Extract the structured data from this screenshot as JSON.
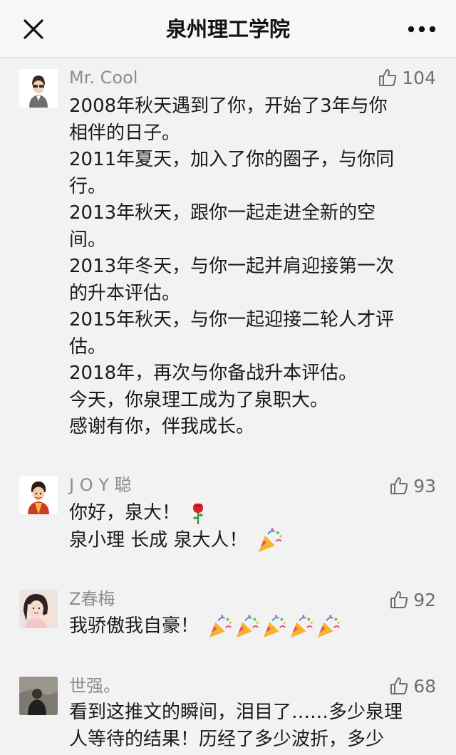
{
  "header": {
    "title": "泉州理工学院",
    "close_icon": "close-icon",
    "more_icon": "more-icon"
  },
  "comments": [
    {
      "name": "Mr. Cool",
      "likes": "104",
      "lines": [
        "2008年秋天遇到了你，开始了3年与你",
        "相伴的日子。",
        "2011年夏天，加入了你的圈子，与你同",
        "行。",
        "2013年秋天，跟你一起走进全新的空",
        "间。",
        "2013年冬天，与你一起并肩迎接第一次",
        "的升本评估。",
        "2015年秋天，与你一起迎接二轮人才评",
        "估。",
        "2018年，再次与你备战升本评估。",
        "今天，你泉理工成为了泉职大。",
        "感谢有你，伴我成长。"
      ]
    },
    {
      "name": "J O Y 聪",
      "likes": "93",
      "lines": [
        "你好，泉大！",
        "泉小理 长成 泉大人！"
      ],
      "emoji": [
        "rose-emoji",
        "party-popper-emoji"
      ]
    },
    {
      "name": "Z春梅",
      "likes": "92",
      "lines": [
        "我骄傲我自豪！"
      ],
      "emoji": [
        "party-popper-emoji"
      ]
    },
    {
      "name": "世强。",
      "likes": "68",
      "lines": [
        "看到这推文的瞬间，泪目了……多少泉理",
        "人等待的结果！历经了多少波折，多少"
      ]
    }
  ],
  "colors": {
    "background": "#f2f2f2",
    "name": "#8c8c8c",
    "text": "#1a1a1a"
  }
}
